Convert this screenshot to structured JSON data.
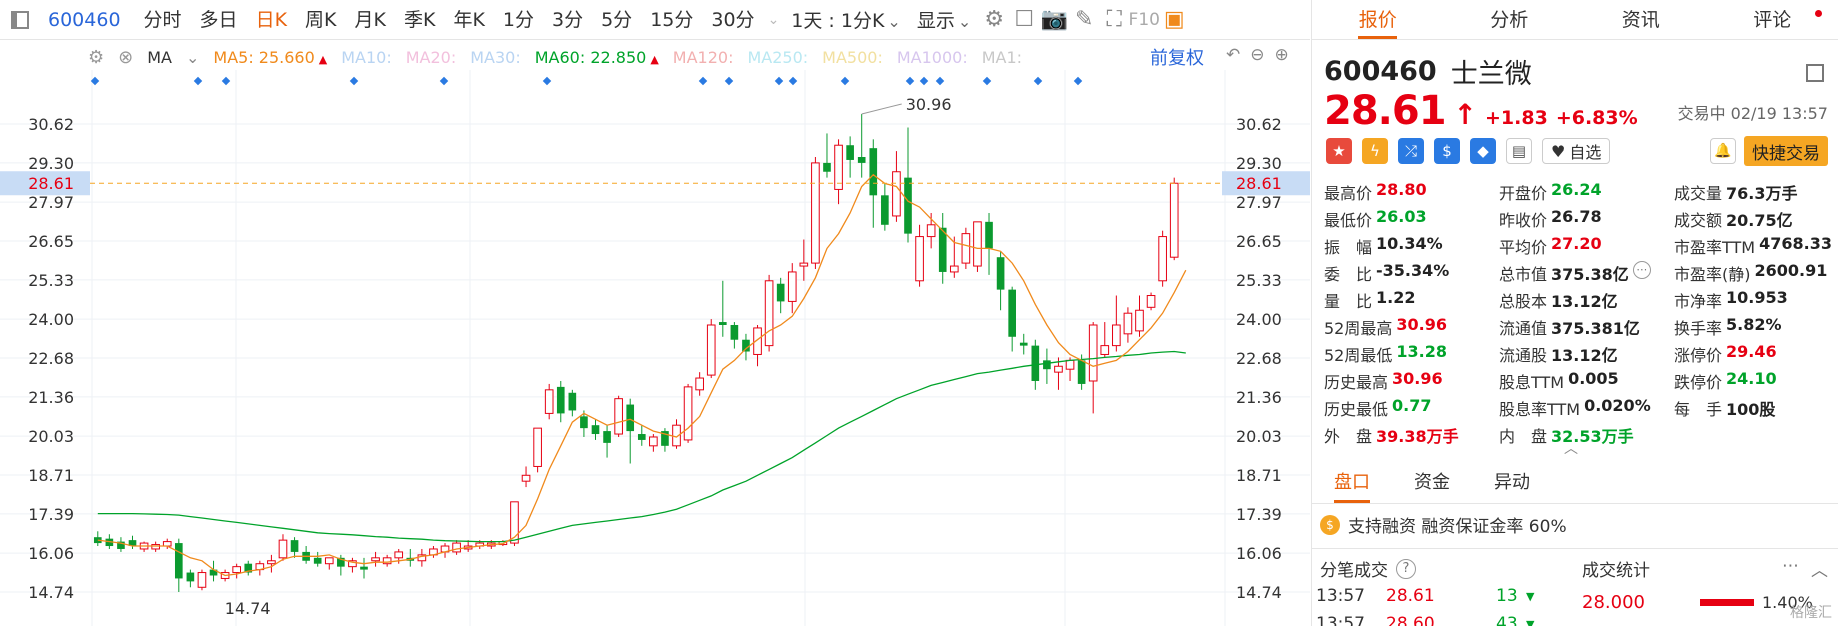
{
  "toolbar": {
    "code": "600460",
    "tabs": [
      "分时",
      "多日",
      "日K",
      "周K",
      "月K",
      "季K",
      "年K",
      "1分",
      "3分",
      "5分",
      "15分",
      "30分"
    ],
    "active_tab": "日K",
    "range_dropdown": "1天 : 1分K",
    "display_dropdown": "显示",
    "f10_label": "F10"
  },
  "ma_bar": {
    "label": "MA",
    "ma5_label": "MA5: 25.660",
    "ma10_label": "MA10:",
    "ma20_label": "MA20:",
    "ma30_label": "MA30:",
    "ma60_label": "MA60: 22.850",
    "ma120_label": "MA120:",
    "ma250_label": "MA250:",
    "ma500_label": "MA500:",
    "ma1000_label": "MA1000:",
    "ma1_label": "MA1:",
    "fuquan": "前复权",
    "colors": {
      "ma5": "#f08a1c",
      "ma10": "#b9d4f2",
      "ma20": "#f2c0dd",
      "ma30": "#b9d4f2",
      "ma60": "#00a32a",
      "ma120": "#f2b0b0",
      "ma250": "#b9e8f2",
      "ma500": "#f2e0a0",
      "ma1000": "#d7c6ee",
      "ma1": "#c8c8c8"
    }
  },
  "chart_data": {
    "type": "candlestick",
    "y_ticks": [
      "30.62",
      "29.30",
      "27.97",
      "26.65",
      "25.33",
      "24.00",
      "22.68",
      "21.36",
      "20.03",
      "18.71",
      "17.39",
      "16.06",
      "14.74"
    ],
    "ylim": [
      14.74,
      30.62
    ],
    "current_price_label": "28.61",
    "current_price": 28.61,
    "high_annotation": "30.96",
    "low_annotation": "14.74",
    "candles": [
      {
        "o": 16.6,
        "h": 16.8,
        "c": 16.4,
        "l": 16.3
      },
      {
        "o": 16.55,
        "h": 16.7,
        "c": 16.3,
        "l": 16.2
      },
      {
        "o": 16.45,
        "h": 16.6,
        "c": 16.2,
        "l": 16.1
      },
      {
        "o": 16.5,
        "h": 16.65,
        "c": 16.3,
        "l": 16.2
      },
      {
        "o": 16.2,
        "h": 16.45,
        "c": 16.4,
        "l": 16.1
      },
      {
        "o": 16.2,
        "h": 16.45,
        "c": 16.35,
        "l": 16.1
      },
      {
        "o": 16.3,
        "h": 16.55,
        "c": 16.45,
        "l": 16.2
      },
      {
        "o": 16.4,
        "h": 16.55,
        "c": 15.2,
        "l": 14.74
      },
      {
        "o": 15.4,
        "h": 15.5,
        "c": 15.1,
        "l": 14.9
      },
      {
        "o": 14.9,
        "h": 15.5,
        "c": 15.4,
        "l": 14.8
      },
      {
        "o": 15.5,
        "h": 15.8,
        "c": 15.3,
        "l": 15.1
      },
      {
        "o": 15.2,
        "h": 15.5,
        "c": 15.4,
        "l": 15.1
      },
      {
        "o": 15.4,
        "h": 15.7,
        "c": 15.6,
        "l": 15.2
      },
      {
        "o": 15.7,
        "h": 15.8,
        "c": 15.4,
        "l": 15.3
      },
      {
        "o": 15.5,
        "h": 15.8,
        "c": 15.7,
        "l": 15.3
      },
      {
        "o": 15.7,
        "h": 16.0,
        "c": 15.8,
        "l": 15.4
      },
      {
        "o": 15.9,
        "h": 16.7,
        "c": 16.5,
        "l": 15.8
      },
      {
        "o": 16.5,
        "h": 16.6,
        "c": 16.1,
        "l": 15.9
      },
      {
        "o": 16.1,
        "h": 16.3,
        "c": 15.8,
        "l": 15.7
      },
      {
        "o": 15.9,
        "h": 16.1,
        "c": 15.7,
        "l": 15.6
      },
      {
        "o": 15.7,
        "h": 15.9,
        "c": 15.9,
        "l": 15.5
      },
      {
        "o": 15.9,
        "h": 16.0,
        "c": 15.6,
        "l": 15.3
      },
      {
        "o": 15.6,
        "h": 15.9,
        "c": 15.8,
        "l": 15.4
      },
      {
        "o": 15.6,
        "h": 15.9,
        "c": 15.5,
        "l": 15.2
      },
      {
        "o": 15.8,
        "h": 16.1,
        "c": 15.9,
        "l": 15.6
      },
      {
        "o": 15.7,
        "h": 16.0,
        "c": 15.9,
        "l": 15.6
      },
      {
        "o": 15.9,
        "h": 16.2,
        "c": 16.1,
        "l": 15.7
      },
      {
        "o": 15.9,
        "h": 16.2,
        "c": 15.8,
        "l": 15.6
      },
      {
        "o": 15.8,
        "h": 16.2,
        "c": 16.0,
        "l": 15.6
      },
      {
        "o": 16.0,
        "h": 16.3,
        "c": 16.2,
        "l": 15.9
      },
      {
        "o": 16.1,
        "h": 16.4,
        "c": 16.3,
        "l": 15.9
      },
      {
        "o": 16.1,
        "h": 16.5,
        "c": 16.4,
        "l": 16.0
      },
      {
        "o": 16.2,
        "h": 16.5,
        "c": 16.3,
        "l": 16.1
      },
      {
        "o": 16.3,
        "h": 16.5,
        "c": 16.4,
        "l": 16.2
      },
      {
        "o": 16.3,
        "h": 16.5,
        "c": 16.4,
        "l": 16.2
      },
      {
        "o": 16.35,
        "h": 16.5,
        "c": 16.45,
        "l": 16.3
      },
      {
        "o": 16.4,
        "h": 17.8,
        "c": 17.8,
        "l": 16.3
      },
      {
        "o": 18.5,
        "h": 19.0,
        "c": 18.7,
        "l": 18.3
      },
      {
        "o": 19.0,
        "h": 20.3,
        "c": 20.3,
        "l": 18.8
      },
      {
        "o": 20.8,
        "h": 21.8,
        "c": 21.6,
        "l": 20.6
      },
      {
        "o": 21.7,
        "h": 21.9,
        "c": 20.8,
        "l": 20.5
      },
      {
        "o": 21.5,
        "h": 21.6,
        "c": 20.9,
        "l": 20.7
      },
      {
        "o": 20.7,
        "h": 20.9,
        "c": 20.3,
        "l": 20.0
      },
      {
        "o": 20.4,
        "h": 20.6,
        "c": 20.1,
        "l": 19.9
      },
      {
        "o": 20.2,
        "h": 20.4,
        "c": 19.8,
        "l": 19.3
      },
      {
        "o": 20.1,
        "h": 21.4,
        "c": 21.3,
        "l": 20.0
      },
      {
        "o": 21.1,
        "h": 21.3,
        "c": 20.2,
        "l": 19.1
      },
      {
        "o": 20.1,
        "h": 20.4,
        "c": 19.9,
        "l": 19.7
      },
      {
        "o": 19.7,
        "h": 20.1,
        "c": 20.0,
        "l": 19.5
      },
      {
        "o": 20.2,
        "h": 20.3,
        "c": 19.7,
        "l": 19.5
      },
      {
        "o": 19.7,
        "h": 20.6,
        "c": 20.4,
        "l": 19.6
      },
      {
        "o": 19.9,
        "h": 21.8,
        "c": 21.7,
        "l": 19.8
      },
      {
        "o": 21.6,
        "h": 22.2,
        "c": 22.0,
        "l": 21.4
      },
      {
        "o": 22.1,
        "h": 24.0,
        "c": 23.8,
        "l": 22.0
      },
      {
        "o": 23.9,
        "h": 25.3,
        "c": 23.8,
        "l": 23.4
      },
      {
        "o": 23.8,
        "h": 23.9,
        "c": 23.3,
        "l": 23.0
      },
      {
        "o": 23.3,
        "h": 23.5,
        "c": 22.9,
        "l": 22.6
      },
      {
        "o": 22.8,
        "h": 23.8,
        "c": 23.7,
        "l": 22.4
      },
      {
        "o": 23.1,
        "h": 25.5,
        "c": 25.3,
        "l": 22.9
      },
      {
        "o": 25.2,
        "h": 25.4,
        "c": 24.6,
        "l": 24.2
      },
      {
        "o": 24.6,
        "h": 25.9,
        "c": 25.6,
        "l": 24.2
      },
      {
        "o": 25.8,
        "h": 26.7,
        "c": 25.9,
        "l": 25.3
      },
      {
        "o": 25.9,
        "h": 29.5,
        "c": 29.3,
        "l": 25.7
      },
      {
        "o": 29.3,
        "h": 30.3,
        "c": 29.0,
        "l": 28.8
      },
      {
        "o": 28.4,
        "h": 30.1,
        "c": 29.9,
        "l": 27.9
      },
      {
        "o": 29.9,
        "h": 30.2,
        "c": 29.4,
        "l": 28.8
      },
      {
        "o": 29.5,
        "h": 30.96,
        "c": 29.3,
        "l": 28.8
      },
      {
        "o": 29.8,
        "h": 30.1,
        "c": 28.2,
        "l": 27.1
      },
      {
        "o": 28.2,
        "h": 28.6,
        "c": 27.2,
        "l": 27.0
      },
      {
        "o": 27.5,
        "h": 29.7,
        "c": 29.0,
        "l": 27.3
      },
      {
        "o": 28.8,
        "h": 30.5,
        "c": 26.9,
        "l": 26.6
      },
      {
        "o": 25.3,
        "h": 27.2,
        "c": 26.8,
        "l": 25.1
      },
      {
        "o": 26.8,
        "h": 27.6,
        "c": 27.2,
        "l": 26.4
      },
      {
        "o": 27.1,
        "h": 27.6,
        "c": 25.6,
        "l": 25.2
      },
      {
        "o": 25.6,
        "h": 26.8,
        "c": 25.8,
        "l": 25.4
      },
      {
        "o": 25.9,
        "h": 27.1,
        "c": 26.9,
        "l": 25.7
      },
      {
        "o": 25.8,
        "h": 27.3,
        "c": 27.3,
        "l": 25.6
      },
      {
        "o": 27.3,
        "h": 27.6,
        "c": 26.4,
        "l": 25.5
      },
      {
        "o": 26.1,
        "h": 26.3,
        "c": 25.0,
        "l": 24.3
      },
      {
        "o": 25.0,
        "h": 25.1,
        "c": 23.4,
        "l": 22.9
      },
      {
        "o": 23.2,
        "h": 23.5,
        "c": 23.1,
        "l": 22.8
      },
      {
        "o": 23.1,
        "h": 23.3,
        "c": 21.9,
        "l": 21.6
      },
      {
        "o": 22.6,
        "h": 23.0,
        "c": 22.3,
        "l": 21.8
      },
      {
        "o": 22.2,
        "h": 22.7,
        "c": 22.4,
        "l": 21.6
      },
      {
        "o": 22.3,
        "h": 22.7,
        "c": 22.6,
        "l": 21.9
      },
      {
        "o": 22.6,
        "h": 22.8,
        "c": 21.8,
        "l": 21.6
      },
      {
        "o": 21.9,
        "h": 23.9,
        "c": 23.8,
        "l": 20.8
      },
      {
        "o": 22.8,
        "h": 23.9,
        "c": 23.1,
        "l": 22.7
      },
      {
        "o": 23.1,
        "h": 24.8,
        "c": 23.8,
        "l": 22.9
      },
      {
        "o": 23.5,
        "h": 24.4,
        "c": 24.2,
        "l": 23.2
      },
      {
        "o": 23.6,
        "h": 24.8,
        "c": 24.3,
        "l": 23.4
      },
      {
        "o": 24.4,
        "h": 24.9,
        "c": 24.8,
        "l": 24.3
      },
      {
        "o": 25.3,
        "h": 27.0,
        "c": 26.8,
        "l": 25.1
      },
      {
        "o": 26.1,
        "h": 28.8,
        "c": 28.61,
        "l": 26.0
      }
    ],
    "ma5": [
      16.5,
      16.45,
      16.4,
      16.3,
      16.3,
      16.3,
      16.3,
      16.1,
      15.9,
      15.8,
      15.5,
      15.3,
      15.35,
      15.45,
      15.5,
      15.6,
      15.85,
      15.95,
      15.95,
      15.95,
      16.0,
      15.85,
      15.75,
      15.7,
      15.75,
      15.75,
      15.8,
      15.85,
      15.95,
      16.0,
      16.1,
      16.2,
      16.25,
      16.3,
      16.35,
      16.38,
      16.6,
      17.0,
      17.9,
      18.9,
      19.7,
      20.5,
      20.8,
      20.6,
      20.4,
      20.5,
      20.6,
      20.4,
      20.2,
      20.1,
      20.0,
      20.3,
      20.7,
      21.5,
      22.3,
      22.6,
      23.0,
      23.3,
      23.6,
      23.8,
      24.1,
      24.7,
      25.4,
      26.4,
      26.9,
      27.6,
      28.5,
      28.9,
      28.6,
      28.5,
      28.0,
      27.8,
      27.4,
      27.0,
      26.6,
      26.5,
      26.4,
      26.4,
      26.3,
      25.9,
      25.3,
      24.5,
      23.8,
      23.2,
      22.8,
      22.6,
      22.4,
      22.5,
      22.6,
      22.9,
      23.3,
      23.7,
      24.2,
      24.9,
      25.66
    ],
    "ma60": [
      17.4,
      17.4,
      17.4,
      17.4,
      17.39,
      17.38,
      17.37,
      17.35,
      17.3,
      17.25,
      17.2,
      17.15,
      17.1,
      17.05,
      17.0,
      16.95,
      16.9,
      16.85,
      16.8,
      16.75,
      16.72,
      16.7,
      16.68,
      16.65,
      16.62,
      16.6,
      16.57,
      16.55,
      16.53,
      16.5,
      16.48,
      16.47,
      16.46,
      16.45,
      16.45,
      16.45,
      16.5,
      16.6,
      16.7,
      16.8,
      16.9,
      17.0,
      17.05,
      17.1,
      17.15,
      17.2,
      17.25,
      17.3,
      17.37,
      17.45,
      17.55,
      17.7,
      17.85,
      18.0,
      18.2,
      18.35,
      18.5,
      18.7,
      18.9,
      19.1,
      19.3,
      19.55,
      19.8,
      20.05,
      20.3,
      20.5,
      20.7,
      20.9,
      21.1,
      21.3,
      21.45,
      21.6,
      21.75,
      21.85,
      21.95,
      22.05,
      22.15,
      22.2,
      22.27,
      22.33,
      22.4,
      22.45,
      22.5,
      22.55,
      22.6,
      22.63,
      22.66,
      22.7,
      22.73,
      22.77,
      22.8,
      22.85,
      22.88,
      22.9,
      22.85
    ]
  },
  "right": {
    "tabs": [
      "报价",
      "分析",
      "资讯",
      "评论"
    ],
    "active_tab": "报价",
    "code": "600460",
    "name": "士兰微",
    "price": "28.61",
    "change": "+1.83",
    "change_pct": "+6.83%",
    "status": "交易中 02/19 13:57",
    "watchlist": "自选",
    "quick_trade": "快捷交易",
    "quotes": [
      [
        {
          "k": "最高价",
          "v": "28.80",
          "c": "red"
        },
        {
          "k": "开盘价",
          "v": "26.24",
          "c": "green"
        },
        {
          "k": "成交量",
          "v": "76.3万手",
          "c": "dark"
        }
      ],
      [
        {
          "k": "最低价",
          "v": "26.03",
          "c": "green"
        },
        {
          "k": "昨收价",
          "v": "26.78",
          "c": "dark"
        },
        {
          "k": "成交额",
          "v": "20.75亿",
          "c": "dark"
        }
      ],
      [
        {
          "k": "振　幅",
          "v": "10.34%",
          "c": "dark"
        },
        {
          "k": "平均价",
          "v": "27.20",
          "c": "red"
        },
        {
          "k": "市盈率TTM",
          "v": "4768.33",
          "c": "dark"
        }
      ],
      [
        {
          "k": "委　比",
          "v": "-35.34%",
          "c": "dark"
        },
        {
          "k": "总市值",
          "v": "375.38亿",
          "c": "dark"
        },
        {
          "k": "市盈率(静)",
          "v": "2600.91",
          "c": "dark"
        }
      ],
      [
        {
          "k": "量　比",
          "v": "1.22",
          "c": "dark"
        },
        {
          "k": "总股本",
          "v": "13.12亿",
          "c": "dark"
        },
        {
          "k": "市净率",
          "v": "10.953",
          "c": "dark"
        }
      ],
      [
        {
          "k": "52周最高",
          "v": "30.96",
          "c": "red"
        },
        {
          "k": "流通值",
          "v": "375.381亿",
          "c": "dark"
        },
        {
          "k": "换手率",
          "v": "5.82%",
          "c": "dark"
        }
      ],
      [
        {
          "k": "52周最低",
          "v": "13.28",
          "c": "green"
        },
        {
          "k": "流通股",
          "v": "13.12亿",
          "c": "dark"
        },
        {
          "k": "涨停价",
          "v": "29.46",
          "c": "red"
        }
      ],
      [
        {
          "k": "历史最高",
          "v": "30.96",
          "c": "red"
        },
        {
          "k": "股息TTM",
          "v": "0.005",
          "c": "dark"
        },
        {
          "k": "跌停价",
          "v": "24.10",
          "c": "green"
        }
      ],
      [
        {
          "k": "历史最低",
          "v": "0.77",
          "c": "green"
        },
        {
          "k": "股息率TTM",
          "v": "0.020%",
          "c": "dark"
        },
        {
          "k": "每　手",
          "v": "100股",
          "c": "dark"
        }
      ],
      [
        {
          "k": "外　盘",
          "v": "39.38万手",
          "c": "red"
        },
        {
          "k": "内　盘",
          "v": "32.53万手",
          "c": "green"
        },
        {
          "k": "",
          "v": "",
          "c": "dark"
        }
      ]
    ],
    "sub_tabs": [
      "盘口",
      "资金",
      "异动"
    ],
    "active_sub_tab": "盘口",
    "margin_text": "支持融资 融资保证金率 60%",
    "tick_title": "分笔成交",
    "stat_title": "成交统计",
    "ticks": [
      {
        "time": "13:57",
        "price": "28.61",
        "vol": "13"
      },
      {
        "time": "13:57",
        "price": "28.60",
        "vol": "43"
      }
    ],
    "stat_price": "28.000",
    "stat_pct": "1.40%",
    "watermark": "格隆汇"
  },
  "colors": {
    "accent": "#e8620c",
    "up": "#e60012",
    "down": "#00a32a",
    "link": "#2a66d9",
    "quick_trade": "#f5a623"
  }
}
